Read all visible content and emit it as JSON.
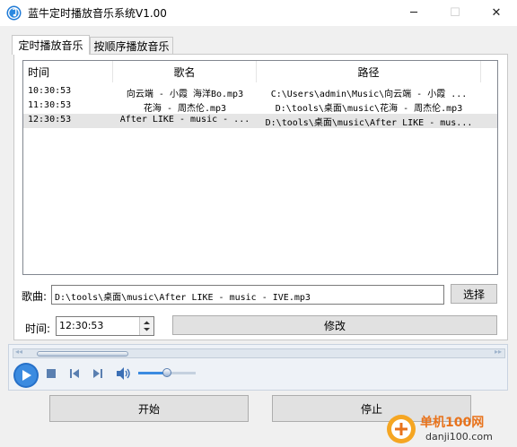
{
  "window": {
    "title": "蓝牛定时播放音乐系统V1.00",
    "minimize": "─",
    "maximize": "☐",
    "close": "✕"
  },
  "tabs": [
    {
      "label": "定时播放音乐",
      "active": true
    },
    {
      "label": "按顺序播放音乐",
      "active": false
    }
  ],
  "table": {
    "columns": [
      "时间",
      "歌名",
      "路径"
    ],
    "rows": [
      {
        "time": "10:30:53",
        "song": "向云端 - 小霞 海洋Bo.mp3",
        "path": "C:\\Users\\admin\\Music\\向云端 - 小霞 ..."
      },
      {
        "time": "11:30:53",
        "song": "花海 - 周杰伦.mp3",
        "path": "D:\\tools\\桌面\\music\\花海 - 周杰伦.mp3"
      },
      {
        "time": "12:30:53",
        "song": "After LIKE - music - ...",
        "path": "D:\\tools\\桌面\\music\\After LIKE - mus..."
      }
    ],
    "selected_row": 2
  },
  "song_field": {
    "label": "歌曲:",
    "value": "D:\\tools\\桌面\\music\\After LIKE - music - IVE.mp3",
    "browse_label": "选择"
  },
  "time_field": {
    "label": "时间:",
    "value": "12:30:53",
    "modify_label": "修改"
  },
  "player": {
    "seek_left": "◂◂",
    "seek_right": "▸▸",
    "volume_fraction": 0.5,
    "seek_position": 0
  },
  "actions": {
    "start_label": "开始",
    "stop_label": "停止"
  },
  "watermark": {
    "site_cn": "单机100网",
    "site_url": "danji100.com"
  },
  "colors": {
    "accent_blue": "#1f7ad6",
    "selected_row_bg": "#e5e5e5"
  }
}
